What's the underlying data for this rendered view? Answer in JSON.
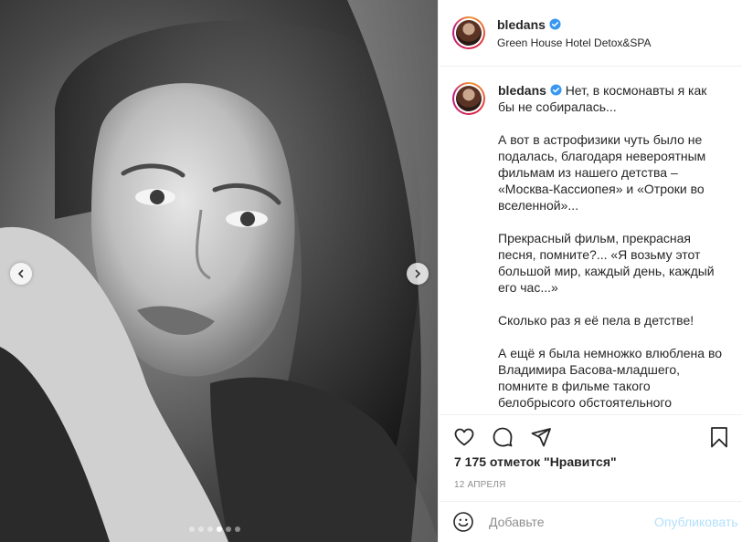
{
  "post": {
    "username": "bledans",
    "location": "Green House Hotel Detox&SPA",
    "caption_paragraphs": [
      "Нет, в космонавты я как бы не собиралась...",
      "А вот в астрофизики чуть было не подалась, благодаря невероятным фильмам из нашего детства – «Москва-Кассиопея» и «Отроки во вселенной»...",
      "Прекрасный фильм, прекрасная песня, помните?... «Я возьму этот большой мир, каждый день, каждый его час...»",
      "Сколько раз я её пела в детстве!",
      "А ещё я была немножко влюблена во Владимира Басова-младшего, помните в фильме такого белобрысого обстоятельного"
    ],
    "likes": "7 175 отметок \"Нравится\"",
    "date": "12 апреля",
    "verified": true
  },
  "carousel": {
    "slide_count": 6,
    "active_index": 3
  },
  "comment": {
    "placeholder": "Добавьте",
    "publish_label": "Опубликовать"
  },
  "icons": {
    "like": "heart-icon",
    "comment": "comment-icon",
    "share": "share-icon",
    "save": "bookmark-icon",
    "emoji": "emoji-icon",
    "verified": "verified-badge-icon",
    "prev": "chevron-left-icon",
    "next": "chevron-right-icon"
  },
  "colors": {
    "accent": "#0095f6",
    "publish_disabled": "#b2dffc",
    "muted": "#8e8e8e"
  }
}
